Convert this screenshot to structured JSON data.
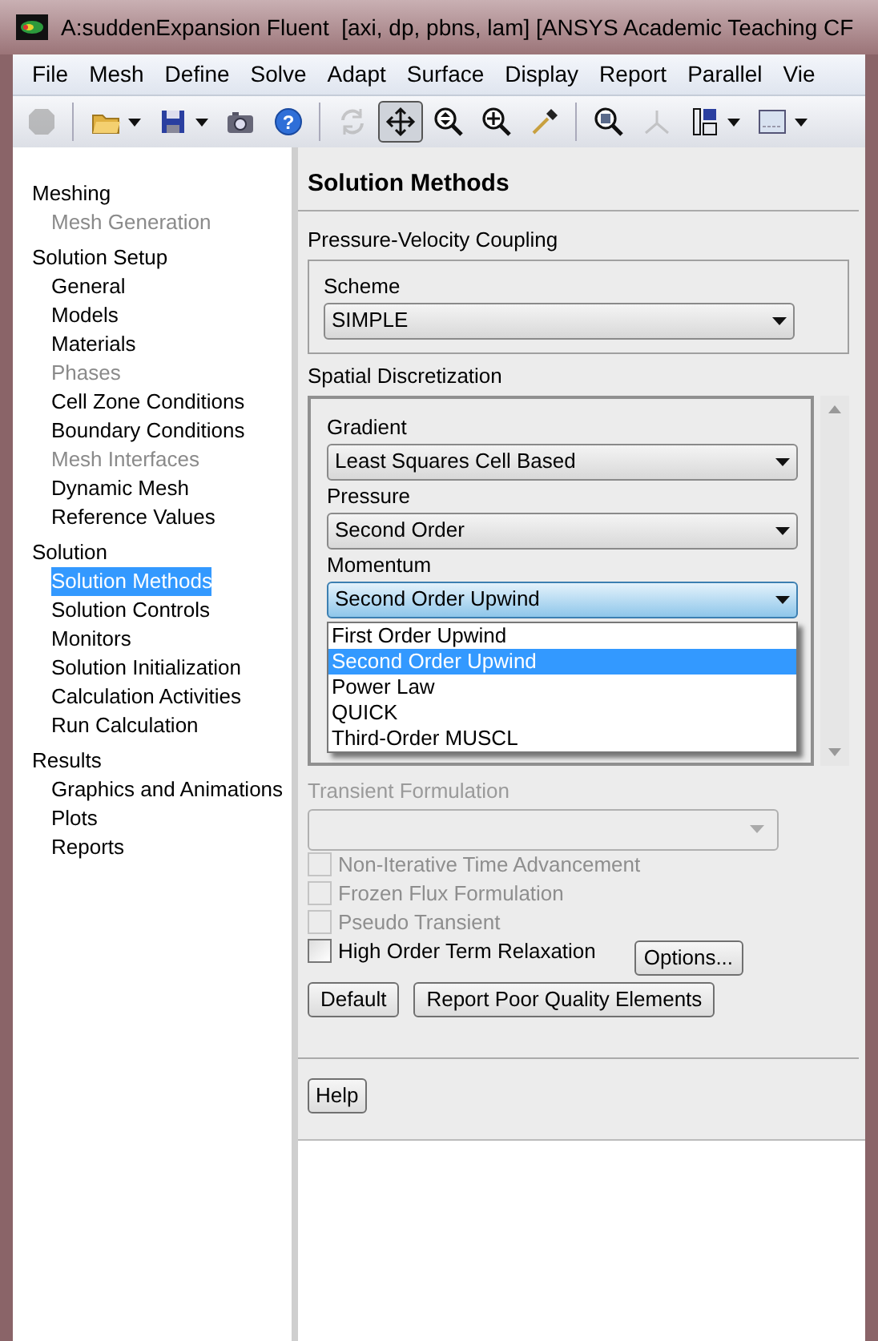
{
  "window": {
    "title": "A:suddenExpansion Fluent  [axi, dp, pbns, lam] [ANSYS Academic Teaching CF"
  },
  "menu": [
    "File",
    "Mesh",
    "Define",
    "Solve",
    "Adapt",
    "Surface",
    "Display",
    "Report",
    "Parallel",
    "Vie"
  ],
  "toolbar": [
    {
      "kind": "stop",
      "disabled": true,
      "selected": false,
      "menu": false
    },
    {
      "kind": "open",
      "disabled": false,
      "selected": false,
      "menu": true
    },
    {
      "kind": "save",
      "disabled": false,
      "selected": false,
      "menu": true
    },
    {
      "kind": "camera",
      "disabled": false,
      "selected": false,
      "menu": false
    },
    {
      "kind": "help",
      "label": "?",
      "disabled": false,
      "selected": false,
      "menu": false
    },
    {
      "kind": "rotate",
      "disabled": true,
      "selected": false,
      "menu": false
    },
    {
      "kind": "pan",
      "disabled": false,
      "selected": true,
      "menu": false
    },
    {
      "kind": "zoom",
      "disabled": false,
      "selected": false,
      "menu": false
    },
    {
      "kind": "zoomin",
      "disabled": false,
      "selected": false,
      "menu": false
    },
    {
      "kind": "probe",
      "disabled": false,
      "selected": false,
      "menu": false
    },
    {
      "kind": "fit",
      "disabled": false,
      "selected": false,
      "menu": false
    },
    {
      "kind": "axes",
      "disabled": true,
      "selected": false,
      "menu": false
    },
    {
      "kind": "layout",
      "disabled": false,
      "selected": false,
      "menu": true
    },
    {
      "kind": "window",
      "disabled": false,
      "selected": false,
      "menu": true
    }
  ],
  "tree": [
    {
      "label": "Meshing",
      "children": [
        {
          "label": "Mesh Generation",
          "disabled": true,
          "selected": false
        }
      ]
    },
    {
      "label": "Solution Setup",
      "children": [
        {
          "label": "General",
          "disabled": false,
          "selected": false
        },
        {
          "label": "Models",
          "disabled": false,
          "selected": false
        },
        {
          "label": "Materials",
          "disabled": false,
          "selected": false
        },
        {
          "label": "Phases",
          "disabled": true,
          "selected": false
        },
        {
          "label": "Cell Zone Conditions",
          "disabled": false,
          "selected": false
        },
        {
          "label": "Boundary Conditions",
          "disabled": false,
          "selected": false
        },
        {
          "label": "Mesh Interfaces",
          "disabled": true,
          "selected": false
        },
        {
          "label": "Dynamic Mesh",
          "disabled": false,
          "selected": false
        },
        {
          "label": "Reference Values",
          "disabled": false,
          "selected": false
        }
      ]
    },
    {
      "label": "Solution",
      "children": [
        {
          "label": "Solution Methods",
          "disabled": false,
          "selected": true
        },
        {
          "label": "Solution Controls",
          "disabled": false,
          "selected": false
        },
        {
          "label": "Monitors",
          "disabled": false,
          "selected": false
        },
        {
          "label": "Solution Initialization",
          "disabled": false,
          "selected": false
        },
        {
          "label": "Calculation Activities",
          "disabled": false,
          "selected": false
        },
        {
          "label": "Run Calculation",
          "disabled": false,
          "selected": false
        }
      ]
    },
    {
      "label": "Results",
      "children": [
        {
          "label": "Graphics and Animations",
          "disabled": false,
          "selected": false
        },
        {
          "label": "Plots",
          "disabled": false,
          "selected": false
        },
        {
          "label": "Reports",
          "disabled": false,
          "selected": false
        }
      ]
    }
  ],
  "panel": {
    "title": "Solution Methods",
    "pressure_velocity_coupling": {
      "label": "Pressure-Velocity Coupling",
      "fields": [
        {
          "label": "Scheme",
          "value": "SIMPLE",
          "expanded": false
        }
      ]
    },
    "spatial_discretization": {
      "label": "Spatial Discretization",
      "fields": [
        {
          "label": "Gradient",
          "value": "Least Squares Cell Based",
          "expanded": false
        },
        {
          "label": "Pressure",
          "value": "Second Order",
          "expanded": false
        },
        {
          "label": "Momentum",
          "value": "Second Order Upwind",
          "expanded": true,
          "options": [
            {
              "label": "First Order Upwind",
              "selected": false
            },
            {
              "label": "Second Order Upwind",
              "selected": true
            },
            {
              "label": "Power Law",
              "selected": false
            },
            {
              "label": "QUICK",
              "selected": false
            },
            {
              "label": "Third-Order MUSCL",
              "selected": false
            }
          ]
        }
      ]
    },
    "transient_formulation": {
      "label": "Transient Formulation",
      "disabled": true
    },
    "checkboxes": [
      {
        "label": "Non-Iterative Time Advancement",
        "checked": false,
        "disabled": true
      },
      {
        "label": "Frozen Flux Formulation",
        "checked": false,
        "disabled": true
      },
      {
        "label": "Pseudo Transient",
        "checked": false,
        "disabled": true
      },
      {
        "label": "High Order Term Relaxation",
        "checked": false,
        "disabled": false
      }
    ],
    "options_button": "Options...",
    "buttons": [
      "Default",
      "Report Poor Quality Elements"
    ],
    "help_button": "Help"
  }
}
